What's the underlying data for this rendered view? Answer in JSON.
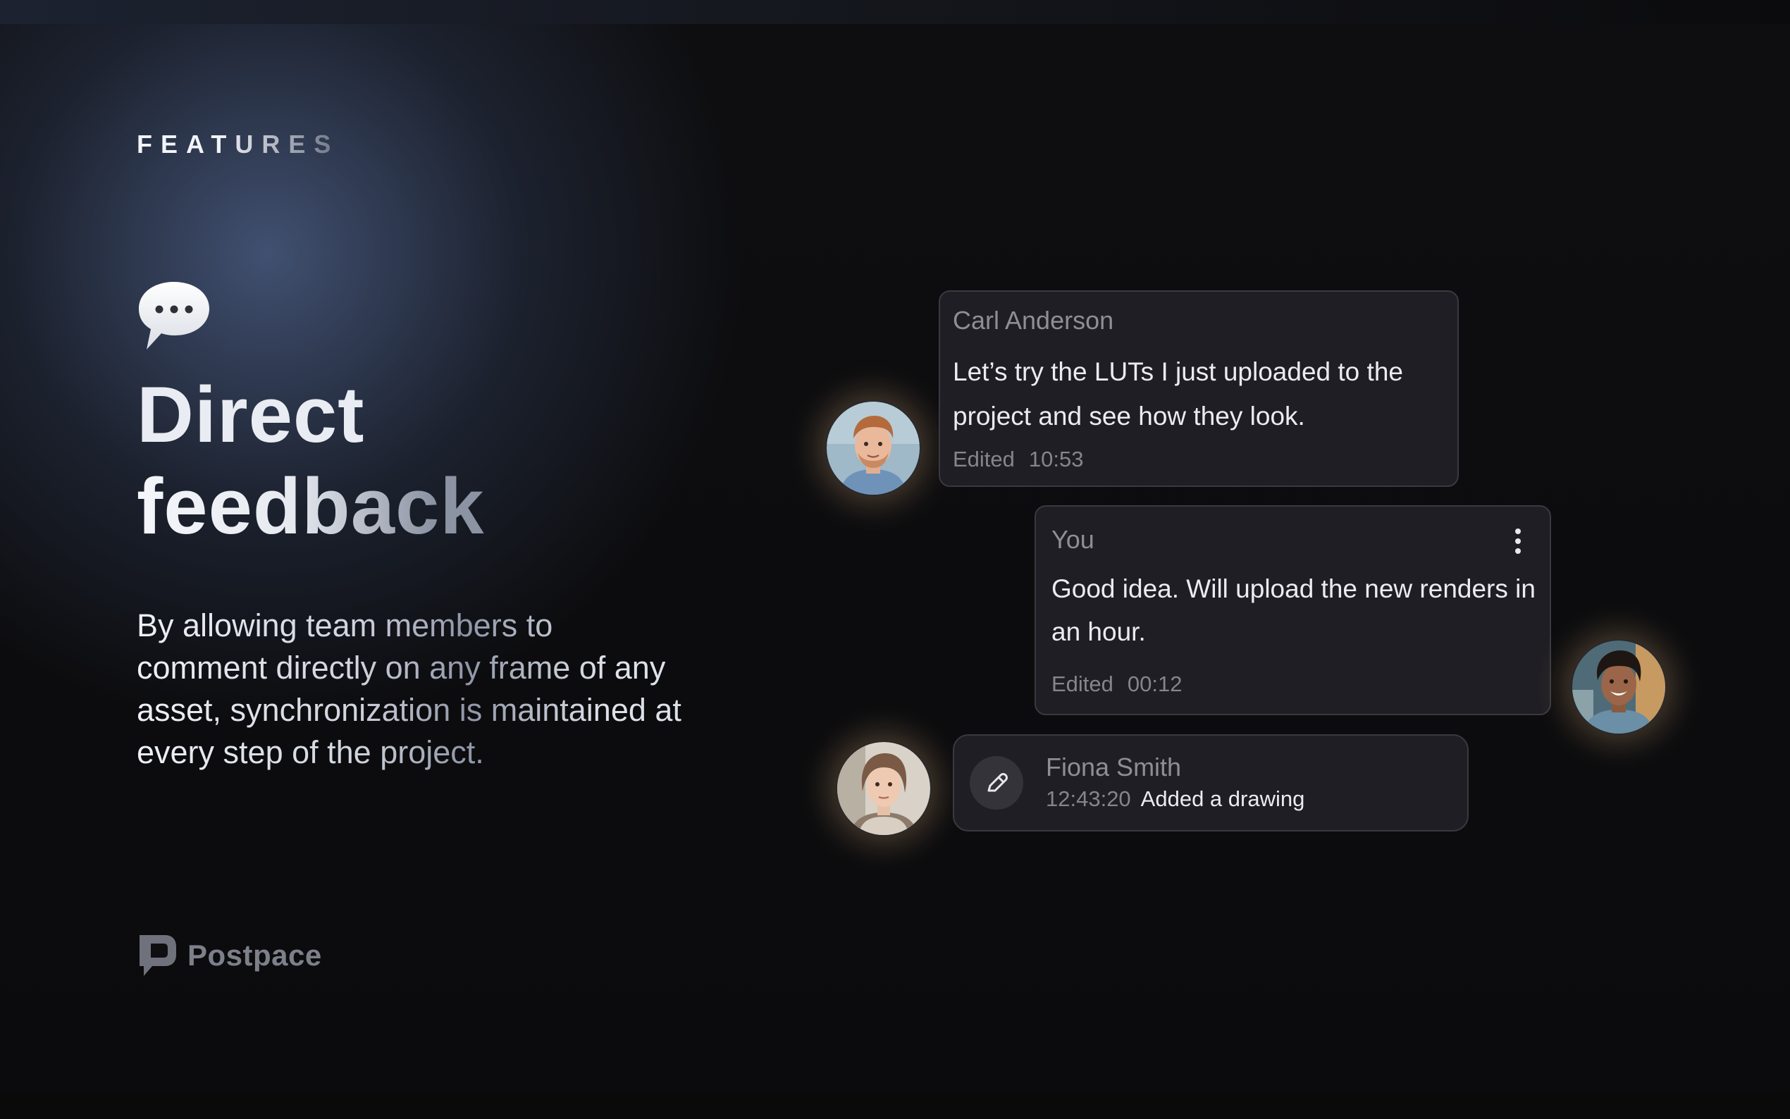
{
  "eyebrow": "FEATURES",
  "icons": {
    "speech": "speech-bubble-icon",
    "more": "more-vertical-icon",
    "pencil": "pencil-icon",
    "brand": "postpace-logo-icon"
  },
  "headline": {
    "line1": "Direct",
    "line2": "feedback"
  },
  "description": "By allowing team members to comment directly on any frame of any asset, synchronization is maintained at every step of the project.",
  "brand": {
    "name": "Postpace"
  },
  "comments": [
    {
      "author": "Carl Anderson",
      "message": "Let’s try the LUTs I just uploaded to the project and see how they look.",
      "status": "Edited",
      "time": "10:53"
    },
    {
      "author": "You",
      "message": "Good idea. Will upload the new renders in an hour.",
      "status": "Edited",
      "time": "00:12"
    }
  ],
  "activity": {
    "author": "Fiona Smith",
    "time": "12:43:20",
    "action": "Added a drawing"
  },
  "colors": {
    "background": "#0d0d0f",
    "card": "#1f1e24",
    "card_border": "#3a3940",
    "avatar_glow": "#d6ac78"
  }
}
